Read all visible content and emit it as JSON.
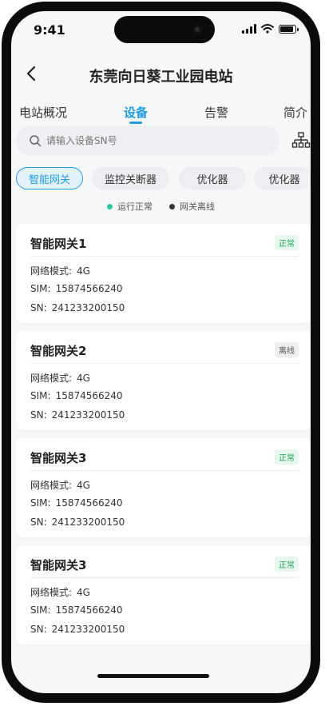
{
  "status_bar": {
    "time": "9:41"
  },
  "header": {
    "title": "东莞向日葵工业园电站"
  },
  "tabs": [
    {
      "label": "电站概况",
      "active": false
    },
    {
      "label": "设备",
      "active": true
    },
    {
      "label": "告警",
      "active": false
    },
    {
      "label": "简介",
      "active": false
    }
  ],
  "search": {
    "placeholder": "请输入设备SN号"
  },
  "chips": [
    {
      "label": "智能网关",
      "active": true
    },
    {
      "label": "监控关断器",
      "active": false
    },
    {
      "label": "优化器",
      "active": false
    },
    {
      "label": "优化器",
      "active": false
    }
  ],
  "legend": [
    {
      "label": "运行正常",
      "color": "#2dc6a0"
    },
    {
      "label": "网关离线",
      "color": "#333333"
    }
  ],
  "colors": {
    "accent": "#1f9de3",
    "normal_bg": "#e6f7ee",
    "normal_fg": "#23a55a",
    "offline_bg": "#eeeeee",
    "offline_fg": "#555555"
  },
  "labels": {
    "mode": "网络模式:",
    "sim": "SIM:",
    "sn": "SN:"
  },
  "devices": [
    {
      "name": "智能网关1",
      "status": "正常",
      "status_type": "normal",
      "mode": "4G",
      "sim": "15874566240",
      "sn": "241233200150"
    },
    {
      "name": "智能网关2",
      "status": "离线",
      "status_type": "offline",
      "mode": "4G",
      "sim": "15874566240",
      "sn": "241233200150"
    },
    {
      "name": "智能网关3",
      "status": "正常",
      "status_type": "normal",
      "mode": "4G",
      "sim": "15874566240",
      "sn": "241233200150"
    },
    {
      "name": "智能网关3",
      "status": "正常",
      "status_type": "normal",
      "mode": "4G",
      "sim": "15874566240",
      "sn": "241233200150"
    }
  ]
}
